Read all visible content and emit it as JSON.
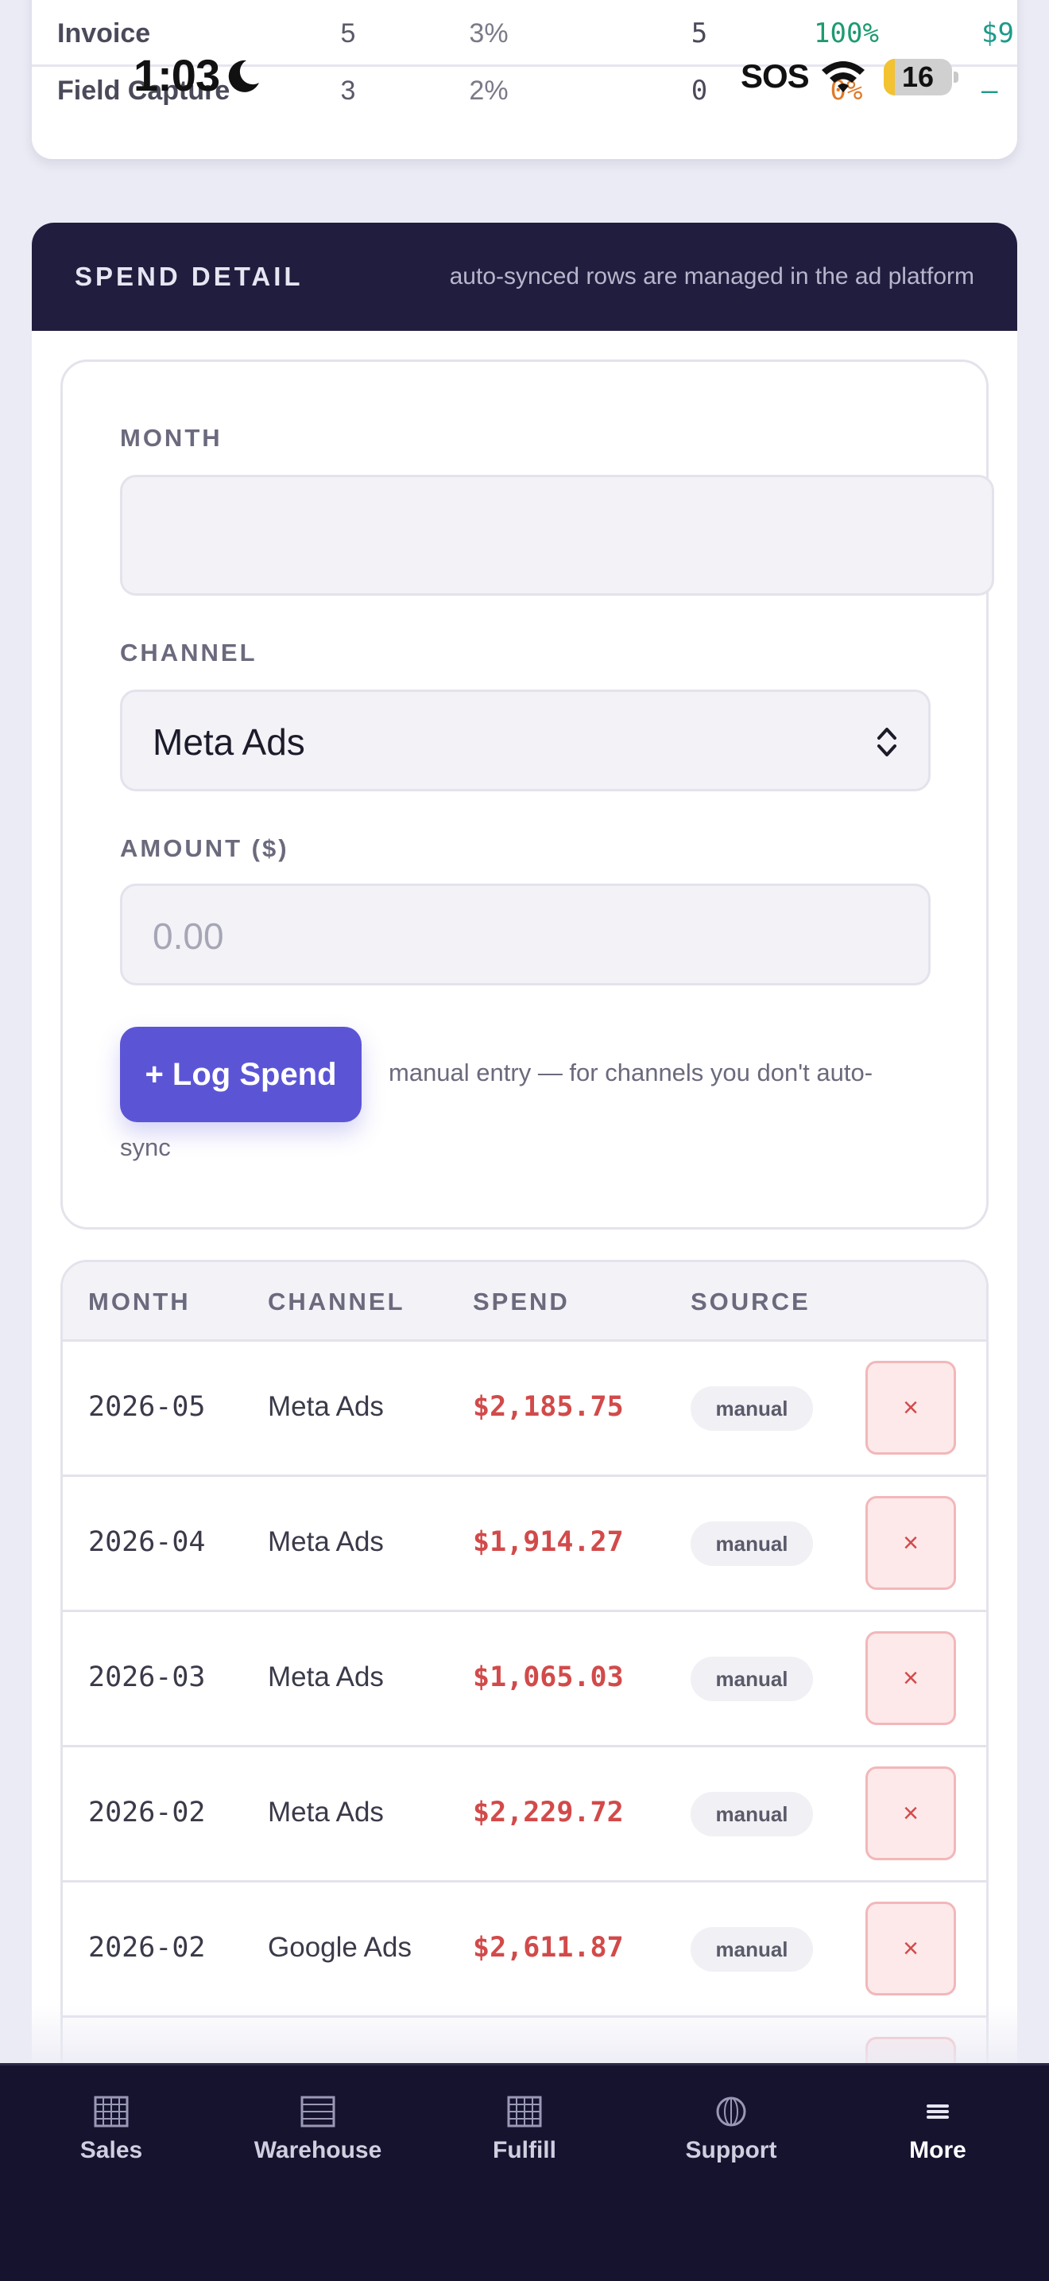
{
  "summary": {
    "rows": [
      {
        "name": "Invoice",
        "c1": "5",
        "c2": "3%",
        "c3": "5",
        "c4": "100%",
        "c5": "$9"
      },
      {
        "name": "Field Capture",
        "c1": "3",
        "c2": "2%",
        "c3": "0",
        "c4": "0%",
        "c5": "–"
      }
    ]
  },
  "status_bar": {
    "time": "1:03",
    "sos": "SOS",
    "battery": "16",
    "battery_level": 0.16
  },
  "spend_detail": {
    "title": "SPEND DETAIL",
    "note": "auto-synced rows are managed in the ad platform",
    "form": {
      "month_label": "MONTH",
      "month_value": "",
      "channel_label": "CHANNEL",
      "channel_value": "Meta Ads",
      "amount_label": "AMOUNT ($)",
      "amount_placeholder": "0.00",
      "submit_label": "+ Log Spend",
      "manual_note_a": "manual entry — for channels you don't auto-",
      "manual_note_b": "sync"
    },
    "table": {
      "headers": {
        "month": "MONTH",
        "channel": "CHANNEL",
        "spend": "SPEND",
        "source": "SOURCE"
      },
      "rows": [
        {
          "month": "2026-05",
          "channel": "Meta Ads",
          "spend": "$2,185.75",
          "source": "manual",
          "delete": "×"
        },
        {
          "month": "2026-04",
          "channel": "Meta Ads",
          "spend": "$1,914.27",
          "source": "manual",
          "delete": "×"
        },
        {
          "month": "2026-03",
          "channel": "Meta Ads",
          "spend": "$1,065.03",
          "source": "manual",
          "delete": "×"
        },
        {
          "month": "2026-02",
          "channel": "Meta Ads",
          "spend": "$2,229.72",
          "source": "manual",
          "delete": "×"
        },
        {
          "month": "2026-02",
          "channel": "Google Ads",
          "spend": "$2,611.87",
          "source": "manual",
          "delete": "×"
        }
      ]
    }
  },
  "bottom_nav": {
    "items": [
      {
        "label": "Sales",
        "icon": "grid-icon"
      },
      {
        "label": "Warehouse",
        "icon": "list-icon"
      },
      {
        "label": "Fulfill",
        "icon": "grid-icon"
      },
      {
        "label": "Support",
        "icon": "globe-icon"
      },
      {
        "label": "More",
        "icon": "menu-icon"
      }
    ]
  },
  "colors": {
    "header_bg": "#201d3e",
    "accent": "#5b55d6",
    "danger": "#d24a4a",
    "positive": "#1d9a72",
    "warning": "#e07a2a",
    "nav_bg": "#15132e"
  }
}
